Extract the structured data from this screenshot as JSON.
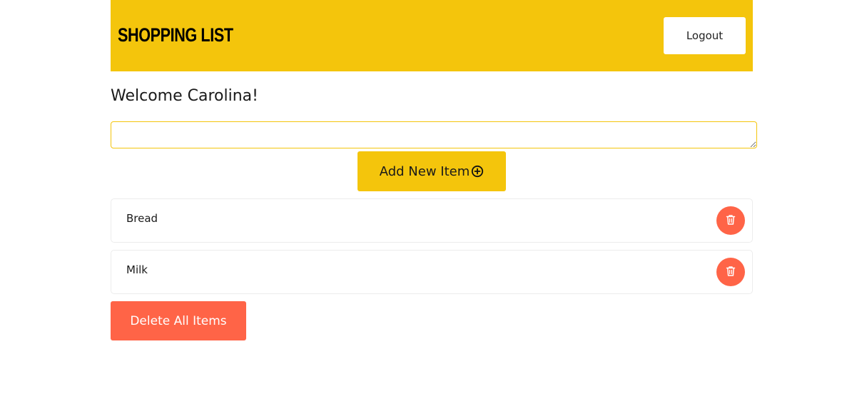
{
  "header": {
    "title": "Shopping List",
    "logout_label": "Logout"
  },
  "welcome": {
    "text": "Welcome Carolina!"
  },
  "new_item": {
    "value": "",
    "placeholder": "",
    "add_label": "Add New Item",
    "add_icon": "plus-circle-icon"
  },
  "items": [
    {
      "label": "Bread",
      "delete_icon": "trash-icon"
    },
    {
      "label": "Milk",
      "delete_icon": "trash-icon"
    }
  ],
  "actions": {
    "delete_all_label": "Delete All Items"
  },
  "colors": {
    "accent": "#f4c50c",
    "danger": "#ff6447",
    "header_text": "#000000",
    "button_text_light": "#ffffff"
  }
}
